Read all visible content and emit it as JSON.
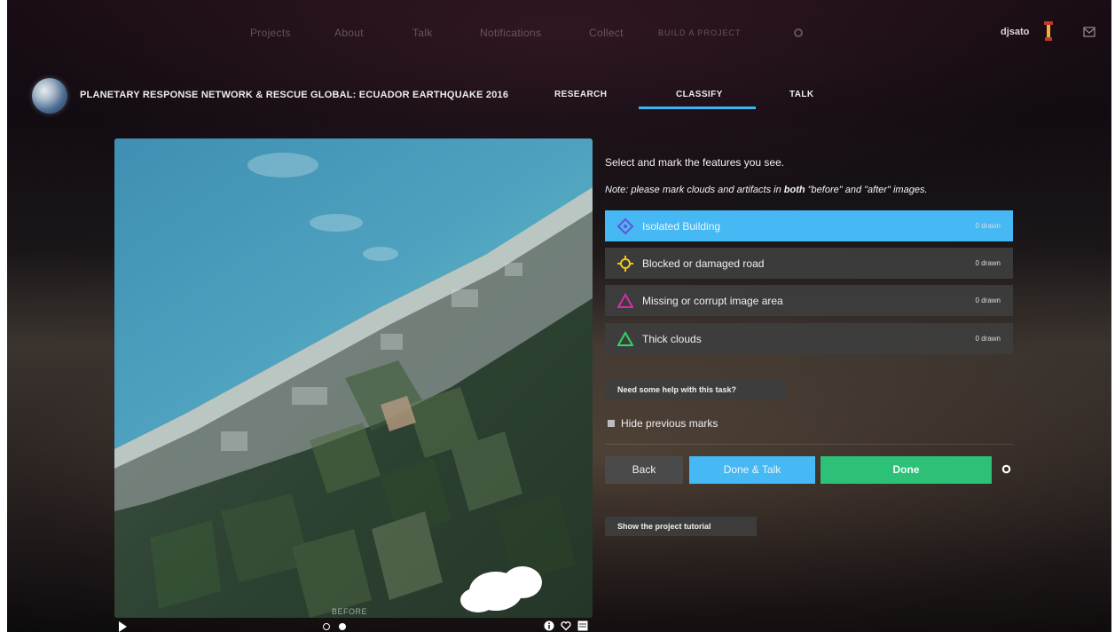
{
  "top_nav": {
    "items": [
      "Projects",
      "About",
      "Talk",
      "Notifications",
      "Collect",
      "BUILD A PROJECT"
    ],
    "user_name": "djsato"
  },
  "project": {
    "title": "PLANETARY RESPONSE NETWORK & RESCUE GLOBAL: ECUADOR EARTHQUAKE 2016",
    "tabs": [
      "RESEARCH",
      "CLASSIFY",
      "TALK"
    ],
    "active_tab": "CLASSIFY"
  },
  "subject": {
    "image_label": "BEFORE",
    "frames": 2,
    "current_frame": 2
  },
  "task": {
    "instruction": "Select and mark the features you see.",
    "note_prefix": "Note: please mark clouds and artifacts in ",
    "note_bold": "both",
    "note_suffix": " \"before\" and \"after\" images.",
    "tools": [
      {
        "label": "Isolated Building",
        "count": "0 drawn",
        "active": true,
        "icon": "diamond-icon",
        "color": "#6b4fd8"
      },
      {
        "label": "Blocked or damaged road",
        "count": "0 drawn",
        "active": false,
        "icon": "crosshair-icon",
        "color": "#f5c518"
      },
      {
        "label": "Missing or corrupt image area",
        "count": "0 drawn",
        "active": false,
        "icon": "triangle-icon",
        "color": "#d22ea8"
      },
      {
        "label": "Thick clouds",
        "count": "0 drawn",
        "active": false,
        "icon": "triangle-icon",
        "color": "#2fd46a"
      }
    ],
    "help_label": "Need some help with this task?",
    "hide_marks_label": "Hide previous marks"
  },
  "actions": {
    "back": "Back",
    "done_talk": "Done & Talk",
    "done": "Done",
    "tutorial": "Show the project tutorial"
  },
  "colors": {
    "accent_blue": "#46b8f3",
    "done_green": "#2dc077",
    "tool_bg": "#3e3e3e"
  }
}
